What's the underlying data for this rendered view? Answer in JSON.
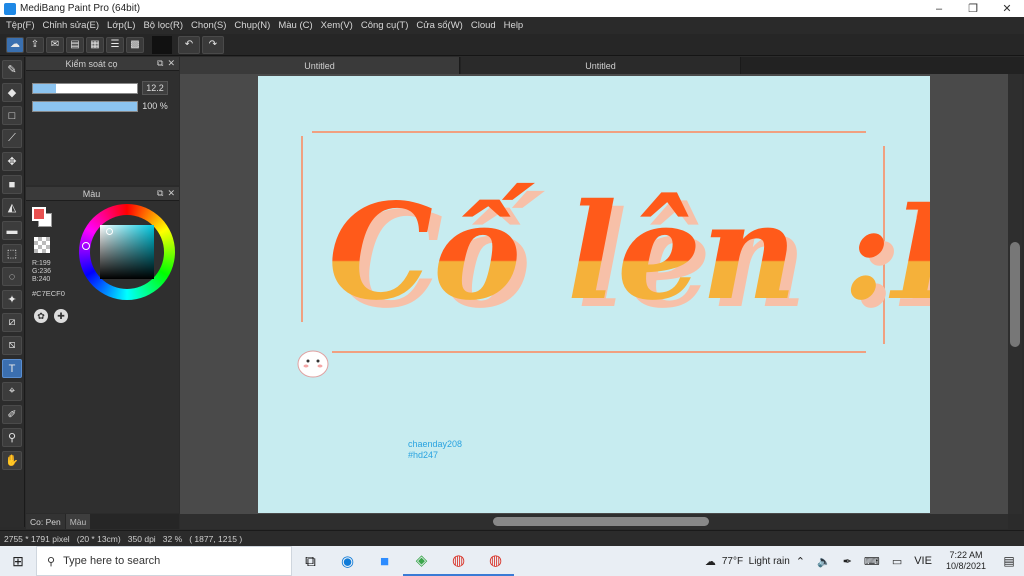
{
  "window": {
    "title": "MediBang Paint Pro (64bit)",
    "minimize": "–",
    "maximize": "❐",
    "close": "✕"
  },
  "menu": [
    "Tệp(F)",
    "Chỉnh sửa(E)",
    "Lớp(L)",
    "Bộ lọc(R)",
    "Chọn(S)",
    "Chụp(N)",
    "Màu (C)",
    "Xem(V)",
    "Công cụ(T)",
    "Cửa sổ(W)",
    "Cloud",
    "Help"
  ],
  "toolbar": {
    "undo": "↶",
    "redo": "↷"
  },
  "brush_panel": {
    "title": "Kiểm soát cọ",
    "size_value": "12.2",
    "size_fill": 0.22,
    "opacity_value": "100 %",
    "opacity_fill": 1.0
  },
  "color_panel": {
    "title": "Màu",
    "r": "R:199",
    "g": "G:236",
    "b": "B:240",
    "hex": "#C7ECF0",
    "foreground": "#e85050",
    "background": "#ffffff"
  },
  "doc_tabs": [
    "Untitled",
    "Untitled"
  ],
  "canvas": {
    "background": "#c7ecf0",
    "headline": "Cố lên :D",
    "credit_line1": "chaenday208",
    "credit_line2": "#hd247",
    "text_top_color": "#ff5a1a",
    "text_bottom_color": "#f5b13a",
    "frame_color": "#f0a080"
  },
  "bottom_tabs": [
    "Co: Pen",
    "Màu"
  ],
  "status": {
    "text": "2755 * 1791 pixel   (20 * 13cm)   350 dpi   32 %   ( 1877, 1215 )"
  },
  "taskbar": {
    "search_placeholder": "Type here to search",
    "weather": "77°F  Light rain",
    "language": "VIE",
    "time": "7:22 AM",
    "date": "10/8/2021"
  }
}
